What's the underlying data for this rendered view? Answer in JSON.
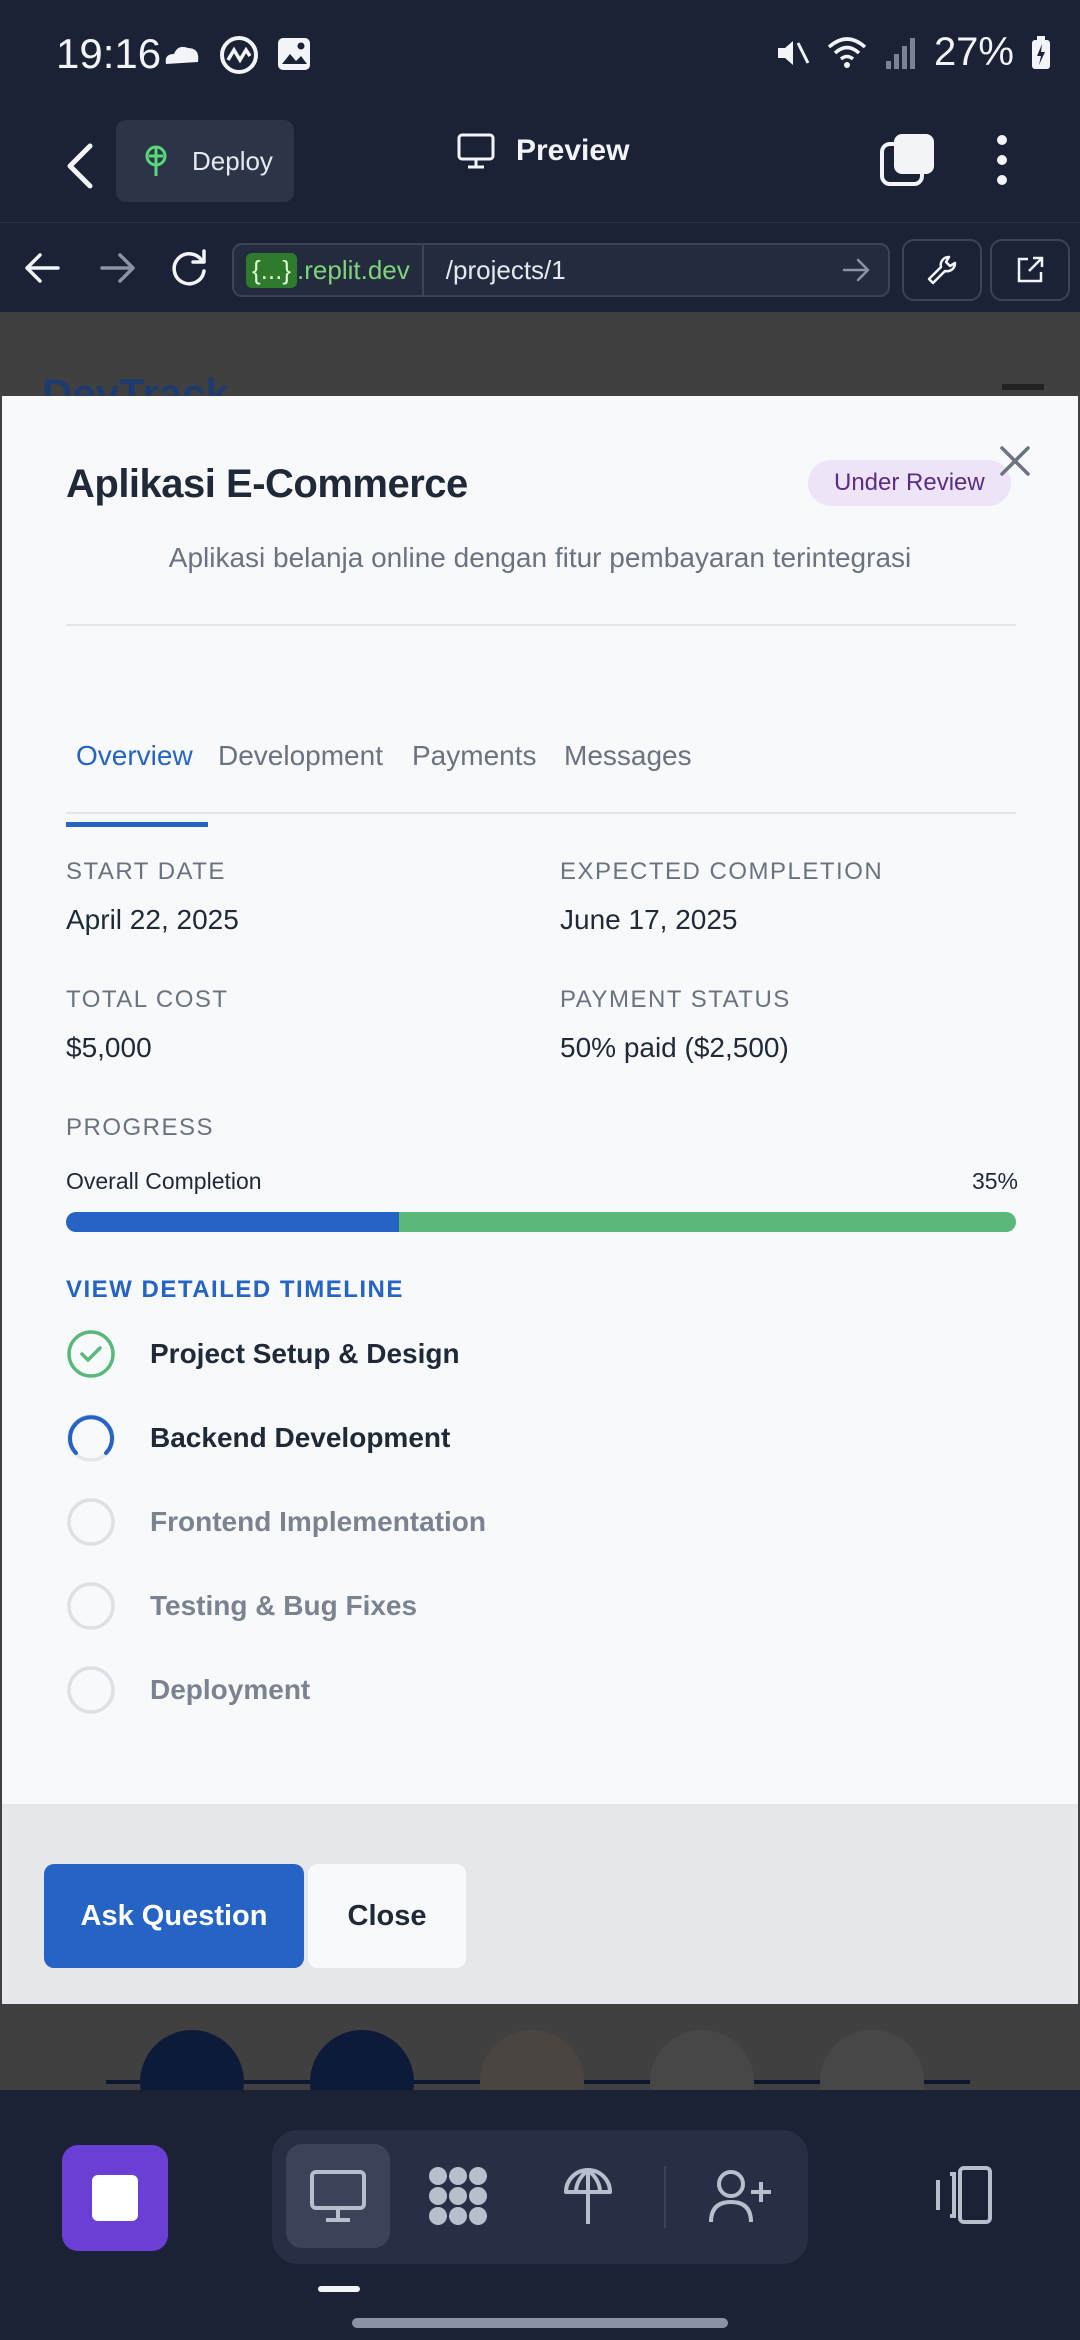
{
  "status_bar": {
    "time": "19:16",
    "battery": "27%",
    "left_icons": [
      "cloud-icon",
      "coinmarketcap-icon",
      "gallery-icon"
    ],
    "right_icons": [
      "mute-icon",
      "wifi-icon",
      "signal-icon",
      "battery-charging-icon"
    ]
  },
  "app_bar": {
    "deploy_label": "Deploy",
    "preview_label": "Preview"
  },
  "url_bar": {
    "host_brace": "{...}",
    "host_domain": ".replit.dev",
    "path": "/projects/1"
  },
  "background_page": {
    "logo": "DevTrack"
  },
  "modal": {
    "title": "Aplikasi E-Commerce",
    "status": "Under Review",
    "description": "Aplikasi belanja online dengan fitur pembayaran terintegrasi",
    "tabs": [
      {
        "label": "Overview",
        "active": true
      },
      {
        "label": "Development",
        "active": false
      },
      {
        "label": "Payments",
        "active": false
      },
      {
        "label": "Messages",
        "active": false
      }
    ],
    "fields": {
      "start_date_label": "START DATE",
      "start_date": "April 22, 2025",
      "expected_completion_label": "EXPECTED COMPLETION",
      "expected_completion": "June 17, 2025",
      "total_cost_label": "TOTAL COST",
      "total_cost": "$5,000",
      "payment_status_label": "PAYMENT STATUS",
      "payment_status": "50% paid ($2,500)"
    },
    "progress": {
      "section_label": "PROGRESS",
      "label": "Overall Completion",
      "percent_text": "35%",
      "value": 0.35
    },
    "timeline": {
      "link_label": "VIEW DETAILED TIMELINE",
      "steps": [
        {
          "label": "Project Setup & Design",
          "state": "completed"
        },
        {
          "label": "Backend Development",
          "state": "in-progress"
        },
        {
          "label": "Frontend Implementation",
          "state": "pending"
        },
        {
          "label": "Testing & Bug Fixes",
          "state": "pending"
        },
        {
          "label": "Deployment",
          "state": "pending"
        }
      ]
    },
    "footer": {
      "ask_label": "Ask Question",
      "close_label": "Close"
    }
  },
  "colors": {
    "accent": "#2563c4",
    "progress_remaining": "#5cb87a",
    "badge_bg": "#ede4f7",
    "badge_text": "#5b2d86",
    "chrome_bg": "#1b2236",
    "stop_button": "#6a3fd6"
  },
  "bottom_bar": {
    "icons": [
      "stop-icon",
      "desktop-preview-icon",
      "workflows-icon",
      "deploy-icon",
      "invite-user-icon",
      "panels-icon"
    ]
  }
}
